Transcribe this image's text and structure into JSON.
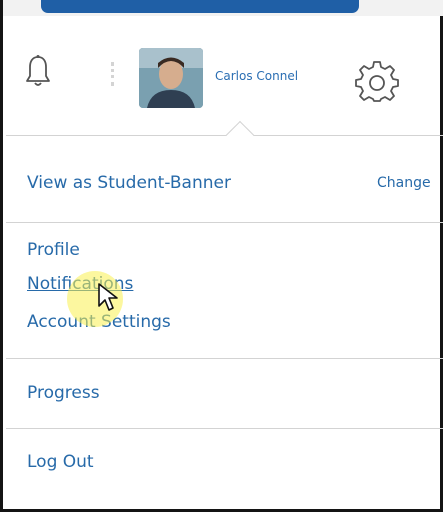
{
  "header": {
    "user_name": "Carlos Connel",
    "icons": [
      "bell-icon",
      "gear-icon"
    ]
  },
  "menu": {
    "view_as": {
      "label": "View as Student-Banner",
      "action": "Change"
    },
    "account_links": [
      "Profile",
      "Notifications",
      "Account Settings"
    ],
    "progress": "Progress",
    "logout": "Log Out"
  },
  "colors": {
    "accent_blue": "#1f5fa6",
    "link": "#276aa9",
    "highlight": "#f7ef55"
  }
}
